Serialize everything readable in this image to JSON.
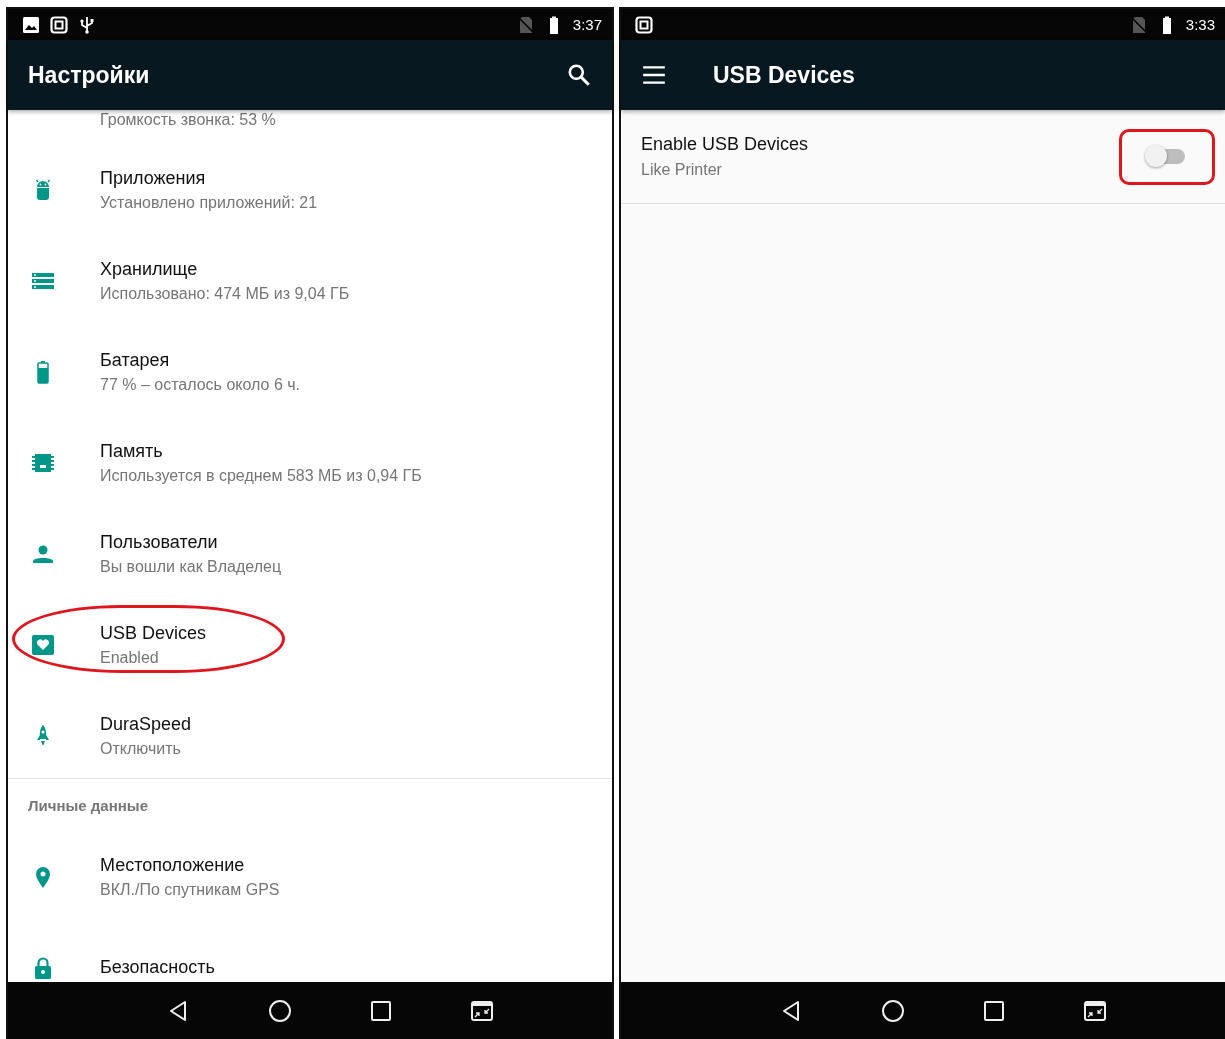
{
  "settings_screen": {
    "status_bar": {
      "time": "3:37"
    },
    "app_bar": {
      "title": "Настройки"
    },
    "sections": [
      {
        "items": [
          {
            "subtitle": "Громкость звонка: 53 %",
            "highlighted": false
          },
          {
            "title": "Приложения",
            "subtitle": "Установлено приложений: 21",
            "highlighted": false
          },
          {
            "title": "Хранилище",
            "subtitle": "Использовано: 474 МБ из 9,04 ГБ",
            "highlighted": false
          },
          {
            "title": "Батарея",
            "subtitle": "77 % – осталось около 6 ч.",
            "highlighted": false
          },
          {
            "title": "Память",
            "subtitle": "Используется в среднем 583 МБ из 0,94 ГБ",
            "highlighted": false
          },
          {
            "title": "Пользователи",
            "subtitle": "Вы вошли как Владелец",
            "highlighted": false
          },
          {
            "title": "USB Devices",
            "subtitle": "Enabled",
            "highlighted": true
          },
          {
            "title": "DuraSpeed",
            "subtitle": "Отключить",
            "highlighted": false
          }
        ]
      },
      {
        "header": "Личные данные",
        "items": [
          {
            "title": "Местоположение",
            "subtitle": "ВКЛ./По спутникам GPS",
            "highlighted": false
          },
          {
            "title": "Безопасность",
            "highlighted": false
          }
        ]
      }
    ]
  },
  "usb_screen": {
    "status_bar": {
      "time": "3:33"
    },
    "app_bar": {
      "title": "USB Devices"
    },
    "setting": {
      "title": "Enable USB Devices",
      "subtitle": "Like Printer",
      "on": false,
      "highlighted": true
    }
  }
}
